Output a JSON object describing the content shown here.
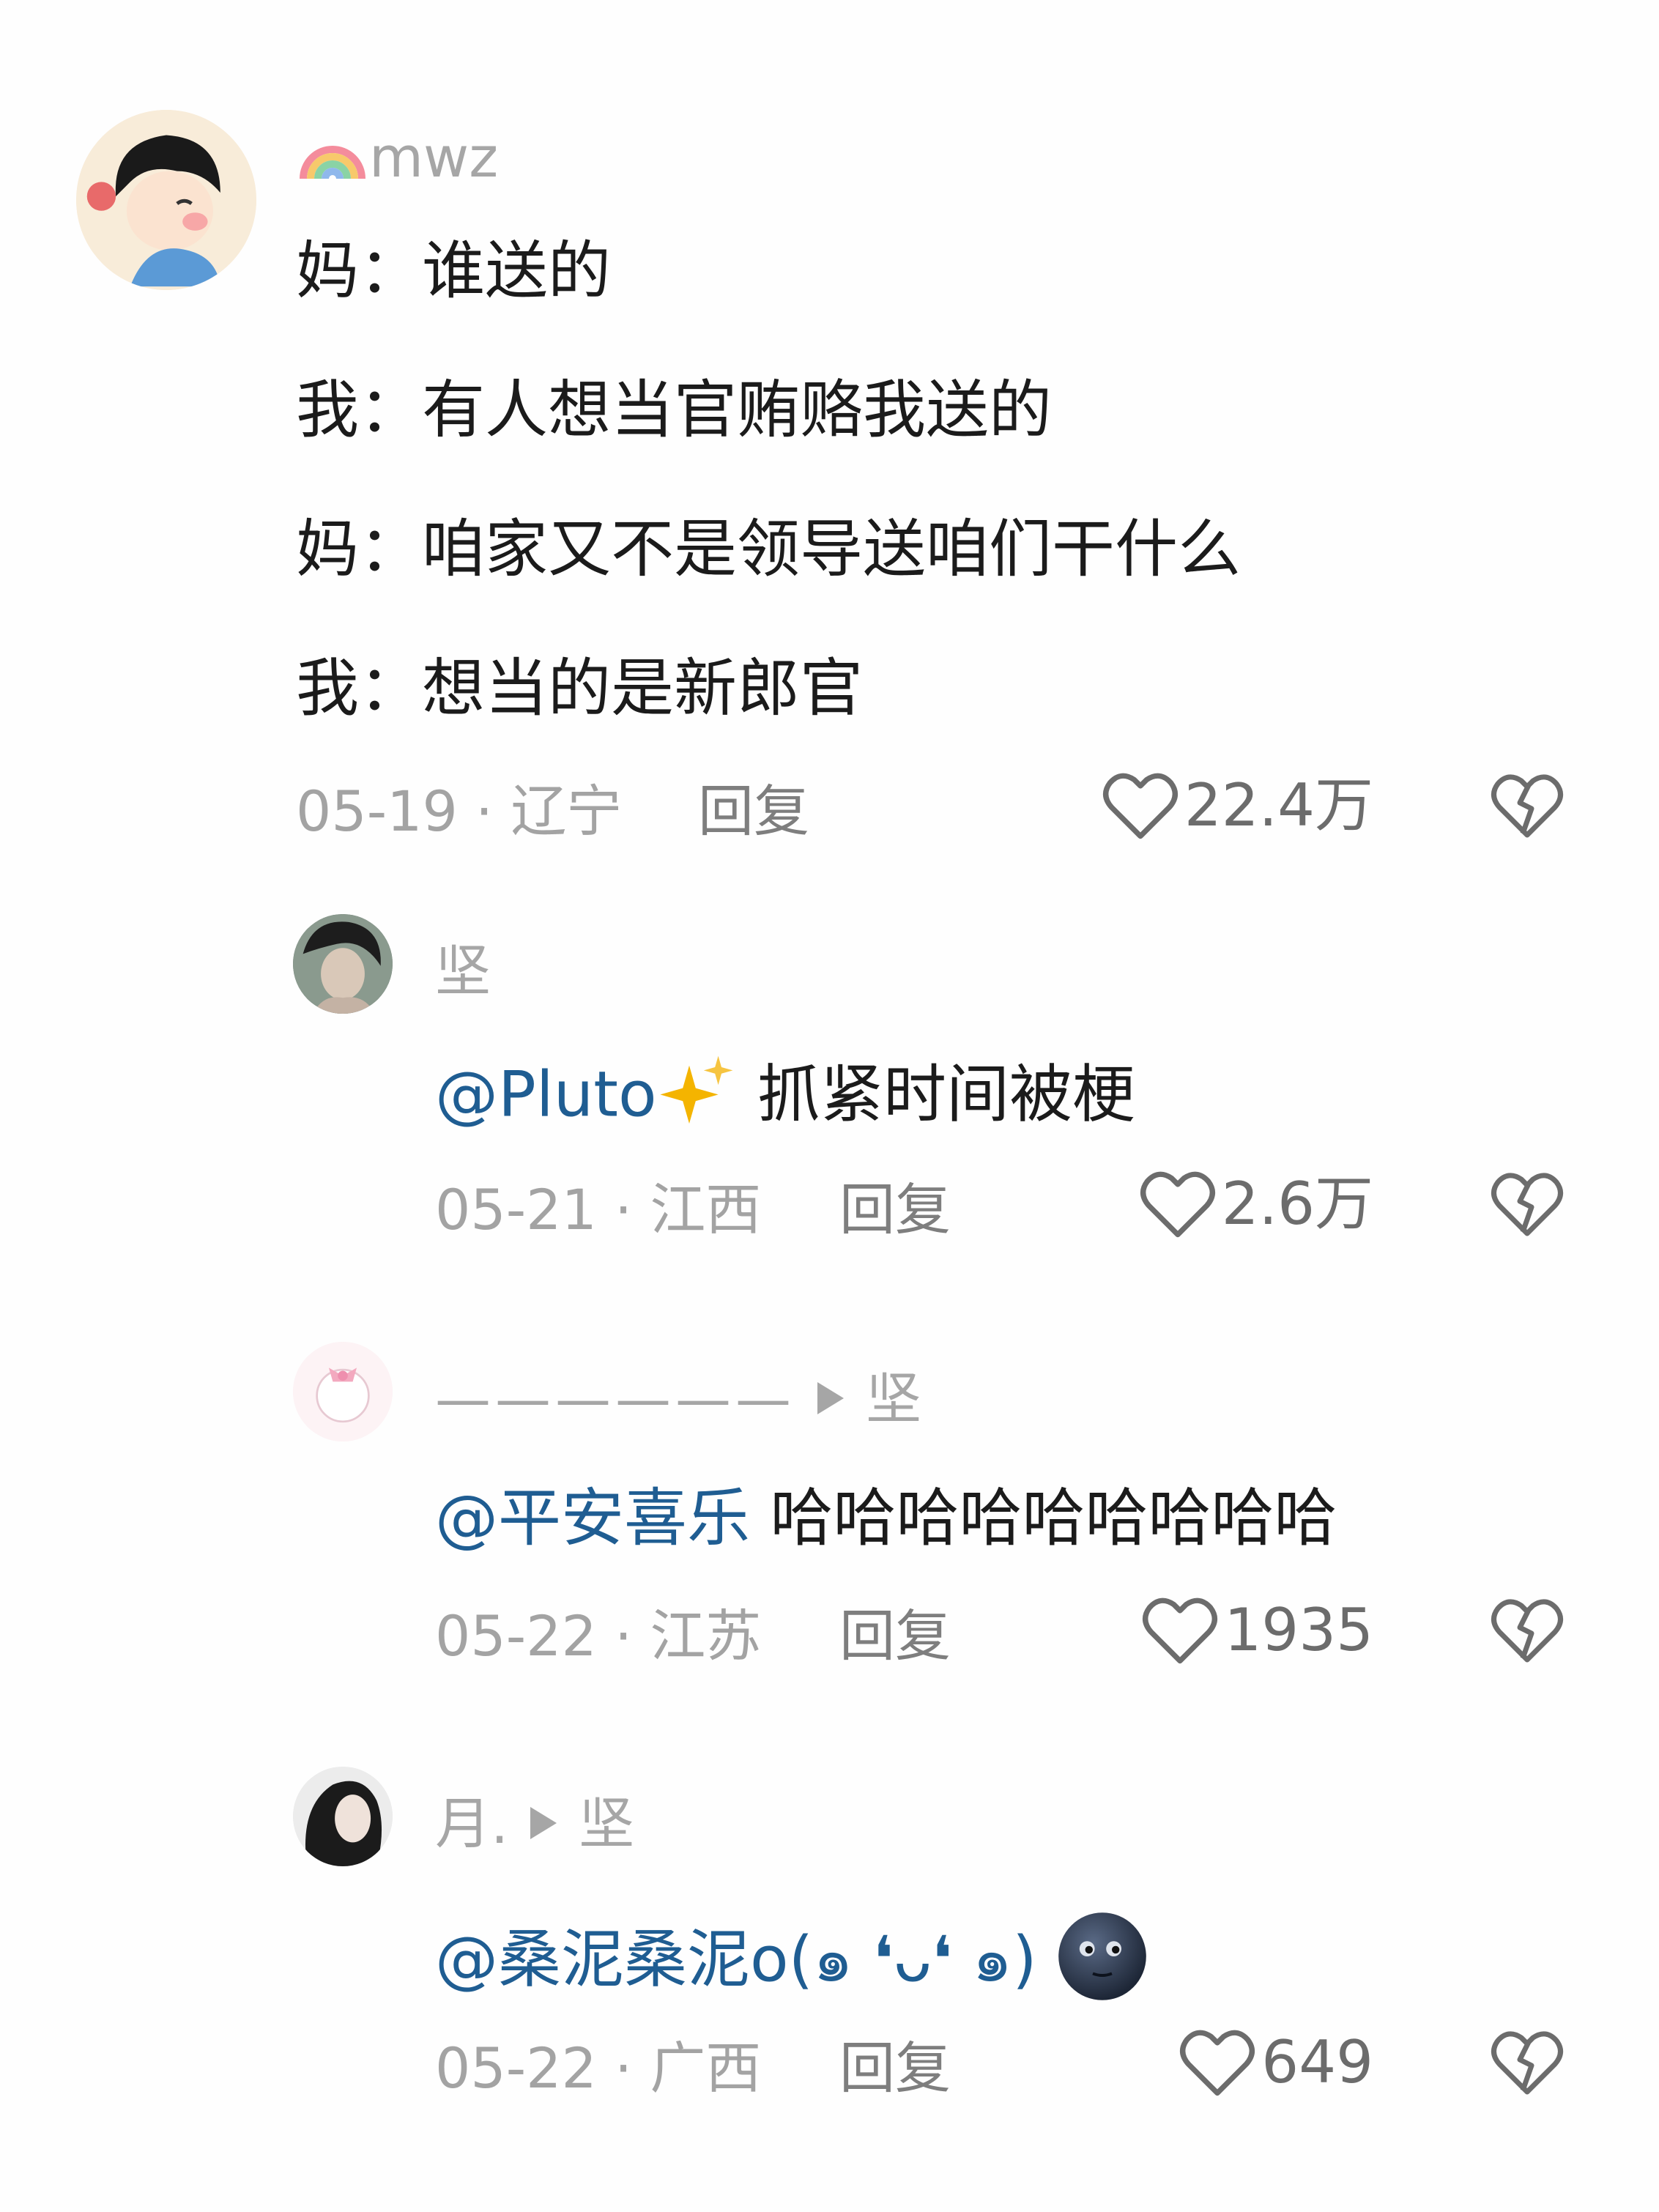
{
  "comments": [
    {
      "username": "mwz",
      "username_icon": "rainbow-icon",
      "lines": [
        "妈：谁送的",
        "我：有人想当官贿赂我送的",
        "妈：咱家又不是领导送咱们干什么",
        "我：想当的是新郎官"
      ],
      "meta": "05-19 · 辽宁",
      "reply_label": "回复",
      "likes": "22.4万"
    },
    {
      "username": "坚",
      "mention": "@Pluto",
      "mention_icon": "sparkles-icon",
      "text": " 抓紧时间被梗",
      "meta": "05-21 · 江西",
      "reply_label": "回复",
      "likes": "2.6万"
    },
    {
      "username": "——————",
      "reply_to": "坚",
      "mention": "@平安喜乐",
      "text": " 哈哈哈哈哈哈哈哈哈",
      "meta": "05-22 · 江苏",
      "reply_label": "回复",
      "likes": "1935"
    },
    {
      "username": "月.",
      "reply_to": "坚",
      "mention": "@桑泥桑泥",
      "text": "o(๑ ❛ᴗ❛ ๑)",
      "text_icon": "new-moon-face-icon",
      "meta": "05-22 · 广西",
      "reply_label": "回复",
      "likes": "649"
    }
  ],
  "colors": {
    "mention": "#1f5d92",
    "meta_text": "#a3a3a3",
    "username": "#a6a6a6",
    "body_text": "#1b1b1b"
  }
}
